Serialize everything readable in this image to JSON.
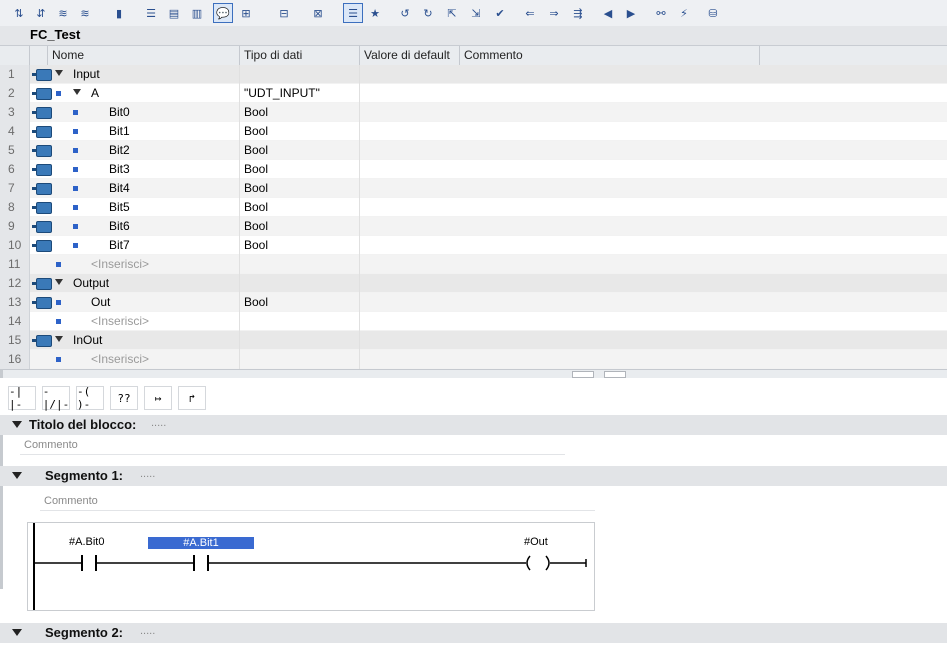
{
  "block_title": "FC_Test",
  "columns": {
    "name": "Nome",
    "type": "Tipo di dati",
    "default": "Valore di default",
    "comment": "Commento"
  },
  "rows": [
    {
      "num": "1",
      "name": "Input",
      "type": "",
      "indent": 0,
      "kind": "section"
    },
    {
      "num": "2",
      "name": "A",
      "type": "\"UDT_INPUT\"",
      "indent": 1,
      "kind": "struct"
    },
    {
      "num": "3",
      "name": "Bit0",
      "type": "Bool",
      "indent": 2,
      "kind": "var"
    },
    {
      "num": "4",
      "name": "Bit1",
      "type": "Bool",
      "indent": 2,
      "kind": "var"
    },
    {
      "num": "5",
      "name": "Bit2",
      "type": "Bool",
      "indent": 2,
      "kind": "var"
    },
    {
      "num": "6",
      "name": "Bit3",
      "type": "Bool",
      "indent": 2,
      "kind": "var"
    },
    {
      "num": "7",
      "name": "Bit4",
      "type": "Bool",
      "indent": 2,
      "kind": "var"
    },
    {
      "num": "8",
      "name": "Bit5",
      "type": "Bool",
      "indent": 2,
      "kind": "var"
    },
    {
      "num": "9",
      "name": "Bit6",
      "type": "Bool",
      "indent": 2,
      "kind": "var"
    },
    {
      "num": "10",
      "name": "Bit7",
      "type": "Bool",
      "indent": 2,
      "kind": "var"
    },
    {
      "num": "11",
      "name": "<Inserisci>",
      "type": "",
      "indent": 1,
      "kind": "placeholder"
    },
    {
      "num": "12",
      "name": "Output",
      "type": "",
      "indent": 0,
      "kind": "section"
    },
    {
      "num": "13",
      "name": "Out",
      "type": "Bool",
      "indent": 1,
      "kind": "var"
    },
    {
      "num": "14",
      "name": "<Inserisci>",
      "type": "",
      "indent": 1,
      "kind": "placeholder"
    },
    {
      "num": "15",
      "name": "InOut",
      "type": "",
      "indent": 0,
      "kind": "section"
    },
    {
      "num": "16",
      "name": "<Inserisci>",
      "type": "",
      "indent": 1,
      "kind": "placeholder"
    }
  ],
  "ladder_toolbar": {
    "no_contact": "-| |-",
    "nc_contact": "-|/|-",
    "coil": "-( )-",
    "empty_box": "??",
    "open_branch": "↦",
    "close_branch": "↱"
  },
  "block_header": {
    "title_label": "Titolo del blocco:",
    "title_dots": ".....",
    "comment": "Commento"
  },
  "segment1": {
    "label": "Segmento 1:",
    "dots": ".....",
    "comment": "Commento",
    "contact1": "#A.Bit0",
    "contact2": "#A.Bit1",
    "coil": "#Out"
  },
  "segment2": {
    "label": "Segmento 2:",
    "dots": "....."
  },
  "colors": {
    "accent": "#3a6ad1",
    "interface_icon": "#3a79b8",
    "header_bg": "#e2e4e7"
  }
}
